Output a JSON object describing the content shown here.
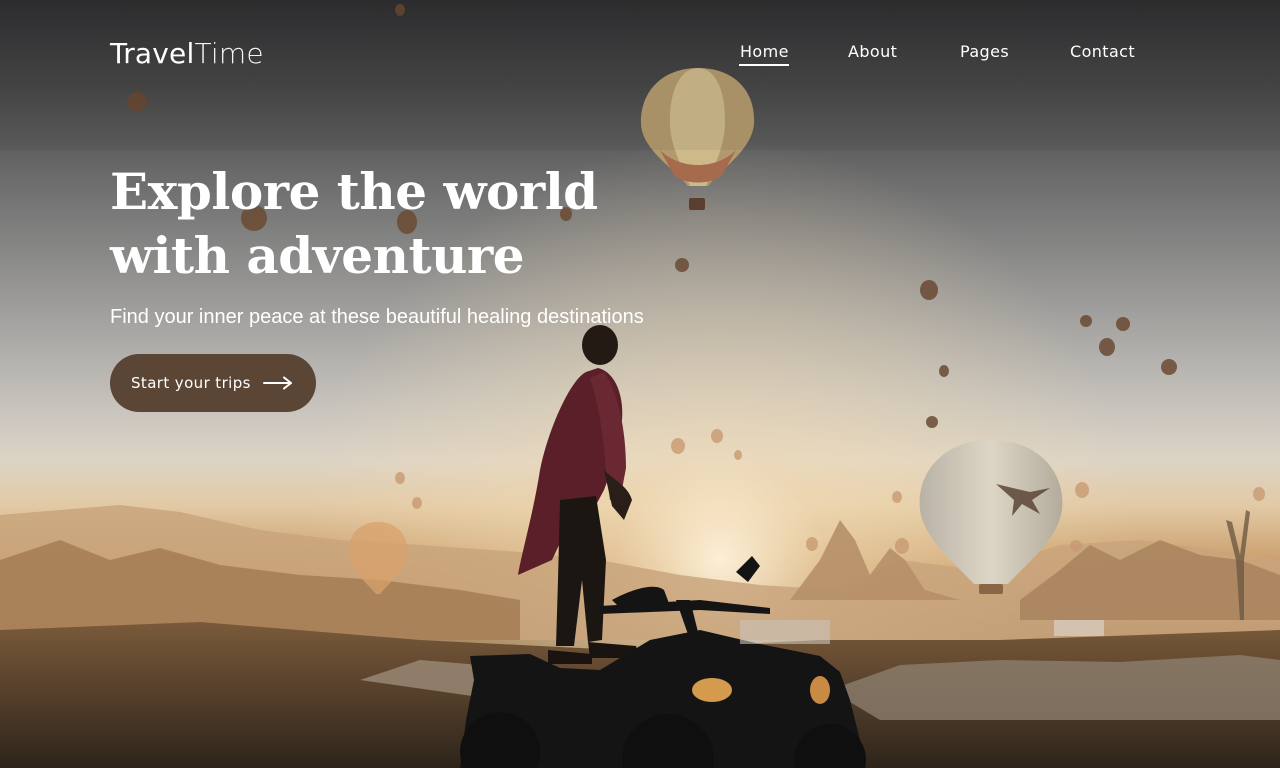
{
  "header": {
    "logo_primary": "Travel",
    "logo_secondary": "Time",
    "nav": [
      {
        "label": "Home",
        "active": true
      },
      {
        "label": "About",
        "active": false
      },
      {
        "label": "Pages",
        "active": false
      },
      {
        "label": "Contact",
        "active": false
      }
    ]
  },
  "hero": {
    "headline": "Explore the world with adventure",
    "subtitle": "Find your inner peace at these beautiful healing destinations",
    "cta_label": "Start your trips",
    "cta_icon": "arrow-right-icon"
  },
  "colors": {
    "cta_background": "#5b4636",
    "text": "#ffffff"
  }
}
